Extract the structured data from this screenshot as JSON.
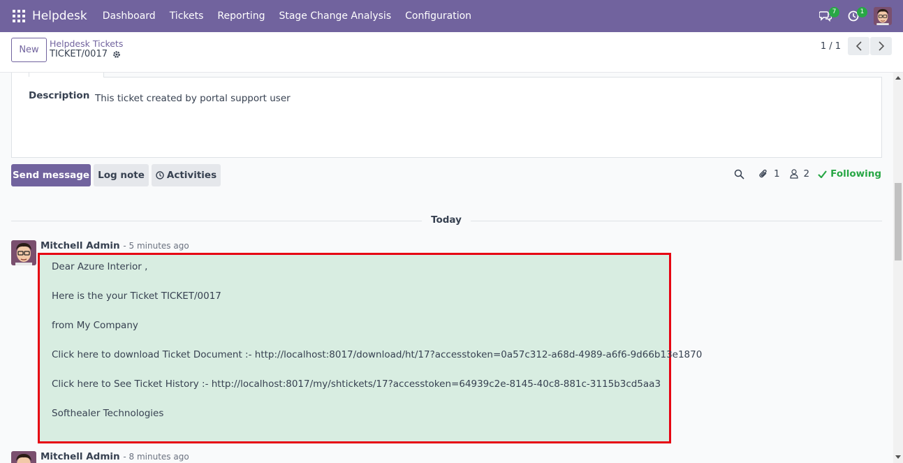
{
  "navbar": {
    "brand": "Helpdesk",
    "menu": [
      "Dashboard",
      "Tickets",
      "Reporting",
      "Stage Change Analysis",
      "Configuration"
    ],
    "messages_badge": "7",
    "activities_badge": "1",
    "color": "#71639e"
  },
  "control": {
    "new_label": "New",
    "breadcrumb_parent": "Helpdesk Tickets",
    "breadcrumb_current": "TICKET/0017",
    "pager": "1 / 1"
  },
  "form": {
    "description_label": "Description",
    "description_value": "This ticket created by portal support user"
  },
  "chatter": {
    "send_message": "Send message",
    "log_note": "Log note",
    "activities": "Activities",
    "attachments_count": "1",
    "followers_count": "2",
    "following_label": "Following",
    "separator": "Today",
    "messages": [
      {
        "author": "Mitchell Admin",
        "date": "- 5 minutes ago",
        "body": [
          "Dear Azure Interior ,",
          "Here is the your Ticket TICKET/0017",
          "from My Company",
          "Click here to download Ticket Document :- http://localhost:8017/download/ht/17?accesstoken=0a57c312-a68d-4989-a6f6-9d66b13e1870",
          "Click here to See Ticket History :- http://localhost:8017/my/shtickets/17?accesstoken=64939c2e-8145-40c8-881c-3115b3cd5aa3",
          "Softhealer Technologies"
        ]
      },
      {
        "author": "Mitchell Admin",
        "date": "- 8 minutes ago"
      }
    ]
  },
  "highlight_color": "#e60012",
  "message_bg": "#d8ede1"
}
